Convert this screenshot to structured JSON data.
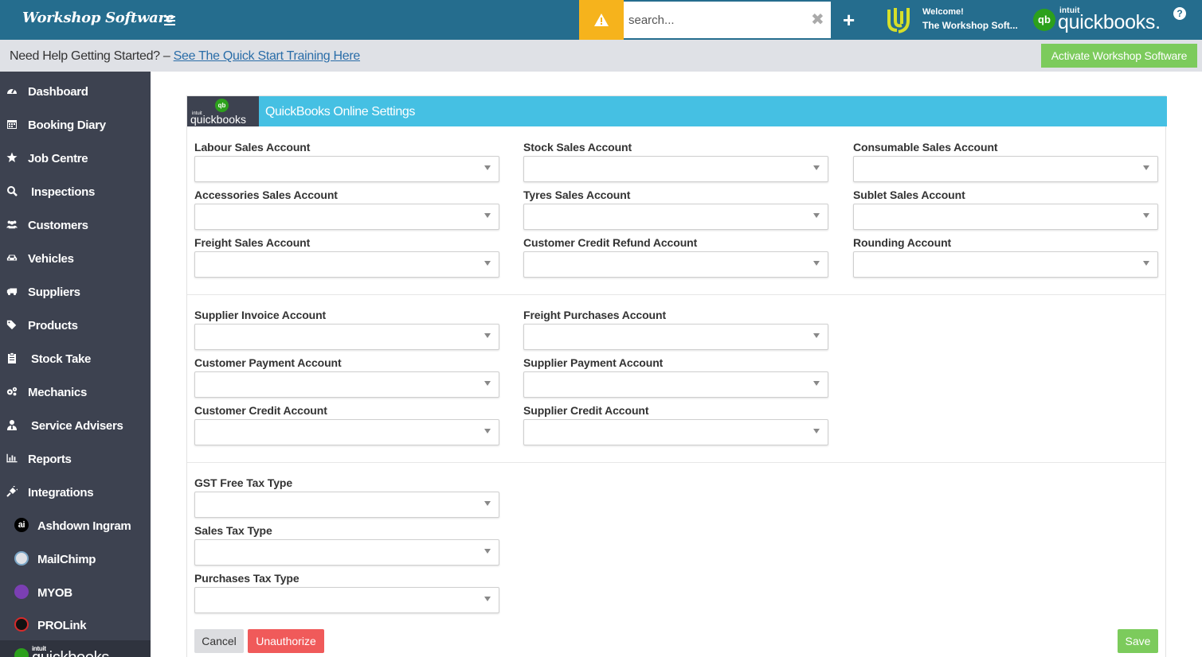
{
  "header": {
    "brand": "Workshop Software",
    "search_placeholder": "search...",
    "welcome": "Welcome!",
    "user_name": "The Workshop Soft...",
    "qb_intuit": "intuit",
    "qb_word": "quickbooks.",
    "help": "?"
  },
  "helpbar": {
    "text": "Need Help Getting Started? – ",
    "link": "See The Quick Start Training Here",
    "activate": "Activate Workshop Software"
  },
  "sidebar": {
    "items": [
      {
        "label": "Dashboard",
        "icon": "dashboard-icon"
      },
      {
        "label": "Booking Diary",
        "icon": "calendar-icon"
      },
      {
        "label": "Job Centre",
        "icon": "star-icon"
      },
      {
        "label": "Inspections",
        "icon": "search-icon"
      },
      {
        "label": "Customers",
        "icon": "users-icon"
      },
      {
        "label": "Vehicles",
        "icon": "car-icon"
      },
      {
        "label": "Suppliers",
        "icon": "truck-icon"
      },
      {
        "label": "Products",
        "icon": "tags-icon"
      },
      {
        "label": "Stock Take",
        "icon": "clipboard-icon"
      },
      {
        "label": "Mechanics",
        "icon": "cogs-icon"
      },
      {
        "label": "Service Advisers",
        "icon": "user-tie-icon"
      },
      {
        "label": "Reports",
        "icon": "bar-chart-icon"
      },
      {
        "label": "Integrations",
        "icon": "plug-icon"
      }
    ],
    "sub_items": [
      {
        "label": "Ashdown Ingram",
        "icon": "ashdown-ingram-logo-icon"
      },
      {
        "label": "MailChimp",
        "icon": "mailchimp-logo-icon"
      },
      {
        "label": "MYOB",
        "icon": "myob-logo-icon"
      },
      {
        "label": "PROLink",
        "icon": "prolink-logo-icon"
      }
    ],
    "active_qb_intuit": "intuit",
    "active_qb_word": "quickbooks"
  },
  "panel": {
    "logo_intuit": "intuit",
    "logo_word": "quickbooks",
    "logo_mark": "qb",
    "title": "QuickBooks Online Settings",
    "section1": [
      {
        "label": "Labour Sales Account",
        "value": ""
      },
      {
        "label": "Stock Sales Account",
        "value": ""
      },
      {
        "label": "Consumable Sales Account",
        "value": ""
      },
      {
        "label": "Accessories Sales Account",
        "value": ""
      },
      {
        "label": "Tyres Sales Account",
        "value": ""
      },
      {
        "label": "Sublet Sales Account",
        "value": ""
      },
      {
        "label": "Freight Sales Account",
        "value": ""
      },
      {
        "label": "Customer Credit Refund Account",
        "value": ""
      },
      {
        "label": "Rounding Account",
        "value": ""
      }
    ],
    "section2": [
      {
        "label": "Supplier Invoice Account",
        "value": ""
      },
      {
        "label": "Freight Purchases Account",
        "value": ""
      },
      {
        "label": "Customer Payment Account",
        "value": ""
      },
      {
        "label": "Supplier Payment Account",
        "value": ""
      },
      {
        "label": "Customer Credit Account",
        "value": ""
      },
      {
        "label": "Supplier Credit Account",
        "value": ""
      }
    ],
    "section3": [
      {
        "label": "GST Free Tax Type",
        "value": ""
      },
      {
        "label": "Sales Tax Type",
        "value": ""
      },
      {
        "label": "Purchases Tax Type",
        "value": ""
      }
    ],
    "buttons": {
      "cancel": "Cancel",
      "unauthorize": "Unauthorize",
      "save": "Save"
    }
  },
  "colors": {
    "header": "#256d8e",
    "warning": "#f6b31c",
    "sidebar": "#3d4250",
    "panel_header": "#45c0e3",
    "qb_green": "#2ca01c",
    "success": "#7ccb5c",
    "danger": "#f05a5a"
  }
}
